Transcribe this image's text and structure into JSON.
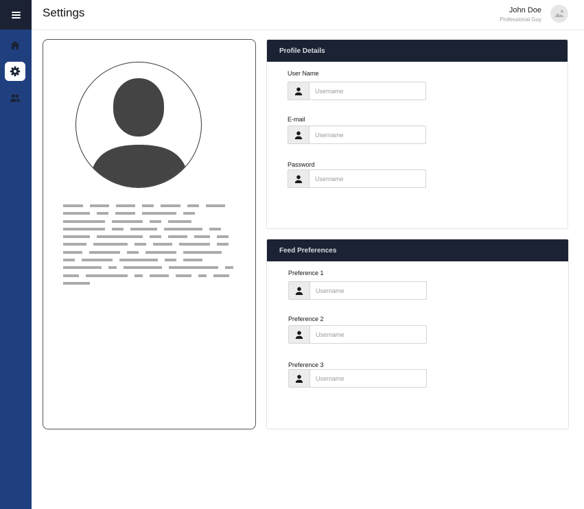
{
  "header": {
    "title": "Settings",
    "user_name": "John Doe",
    "user_role": "Professional Guy"
  },
  "sidebar": {
    "items": [
      {
        "icon": "home-icon",
        "active": false
      },
      {
        "icon": "gear-icon",
        "active": true
      },
      {
        "icon": "users-icon",
        "active": false
      }
    ]
  },
  "profile_details": {
    "title": "Profile Details",
    "fields": [
      {
        "label": "User Name",
        "placeholder": "Username",
        "icon": "user-icon"
      },
      {
        "label": "E-mail",
        "placeholder": "Username",
        "icon": "user-icon"
      },
      {
        "label": "Password",
        "placeholder": "Username",
        "icon": "user-icon"
      }
    ]
  },
  "feed_preferences": {
    "title": "Feed Preferences",
    "fields": [
      {
        "label": "Preference 1",
        "placeholder": "Username",
        "icon": "user-icon"
      },
      {
        "label": "Preference 2",
        "placeholder": "Username",
        "icon": "user-icon"
      },
      {
        "label": "Preference 3",
        "placeholder": "Username",
        "icon": "user-icon"
      }
    ]
  },
  "colors": {
    "sidebar": "#1f3f7f",
    "header_dark": "#1a2233",
    "avatar_fill": "#444444",
    "placeholder_bar": "#ababab"
  }
}
